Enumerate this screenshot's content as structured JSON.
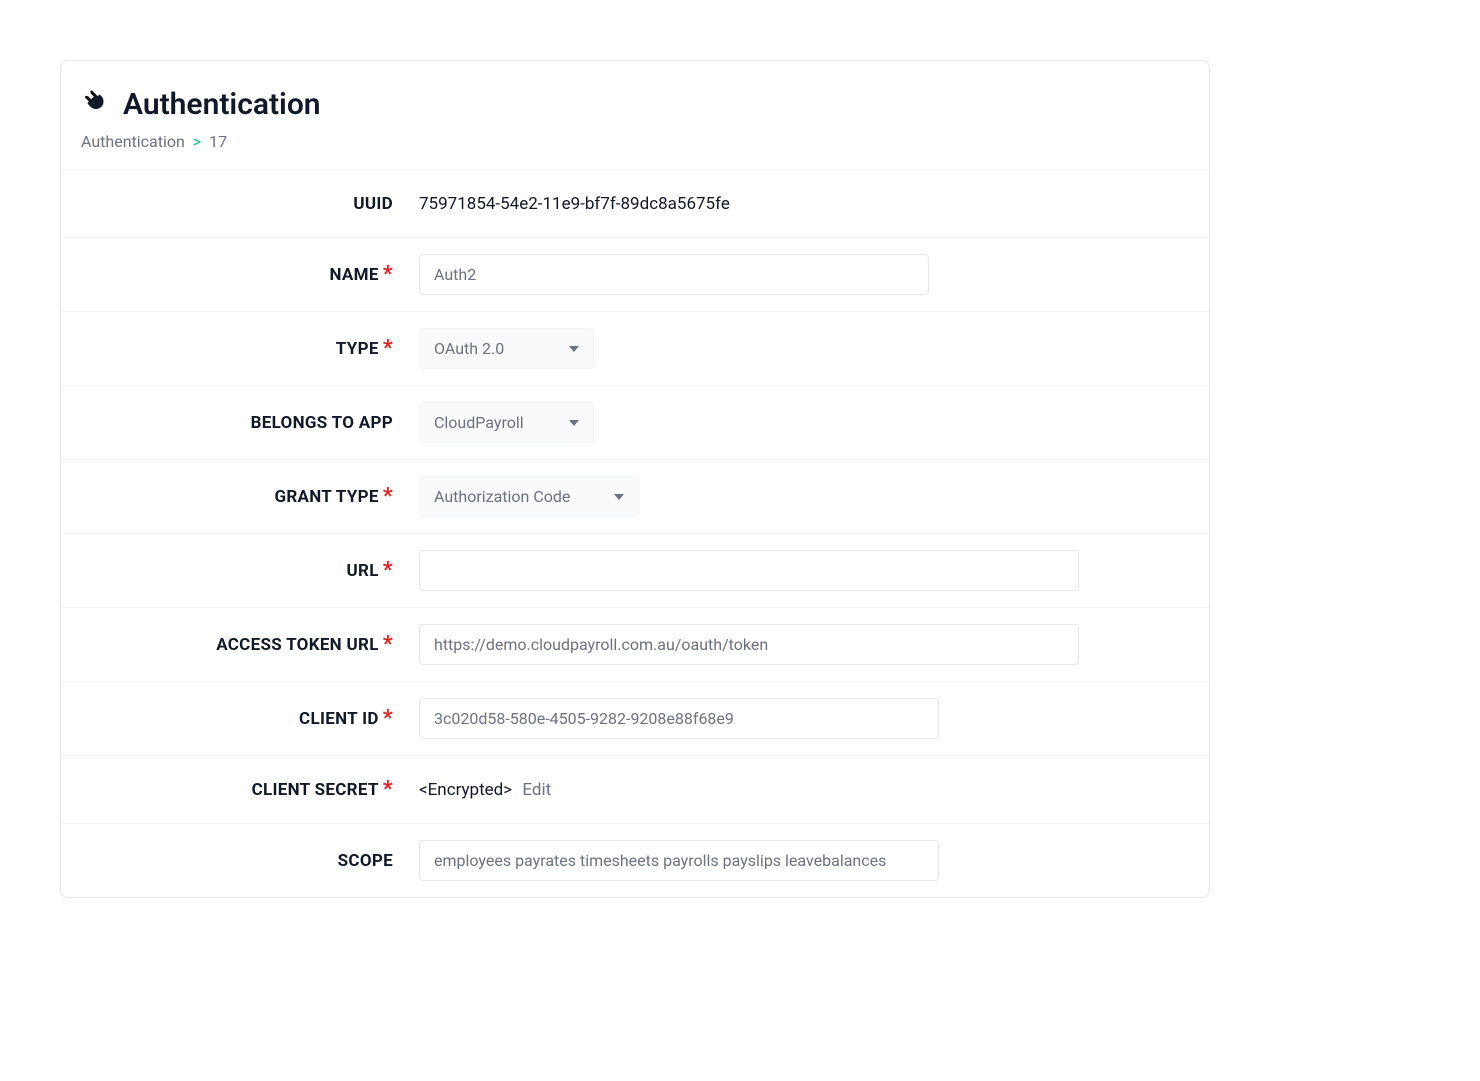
{
  "header": {
    "title": "Authentication"
  },
  "breadcrumb": {
    "parent": "Authentication",
    "separator": ">",
    "current": "17"
  },
  "fields": {
    "uuid": {
      "label": "UUID",
      "value": "75971854-54e2-11e9-bf7f-89dc8a5675fe"
    },
    "name": {
      "label": "NAME",
      "value": "Auth2"
    },
    "type": {
      "label": "TYPE",
      "value": "OAuth 2.0"
    },
    "belongs_to_app": {
      "label": "BELONGS TO APP",
      "value": "CloudPayroll"
    },
    "grant_type": {
      "label": "GRANT TYPE",
      "value": "Authorization Code"
    },
    "url": {
      "label": "URL",
      "value": ""
    },
    "access_token_url": {
      "label": "ACCESS TOKEN URL",
      "value": "https://demo.cloudpayroll.com.au/oauth/token"
    },
    "client_id": {
      "label": "CLIENT ID",
      "value": "3c020d58-580e-4505-9282-9208e88f68e9"
    },
    "client_secret": {
      "label": "CLIENT SECRET",
      "value": "<Encrypted>",
      "edit_label": "Edit"
    },
    "scope": {
      "label": "SCOPE",
      "value": "employees payrates timesheets payrolls payslips leavebalances"
    }
  },
  "required_marker": "*"
}
